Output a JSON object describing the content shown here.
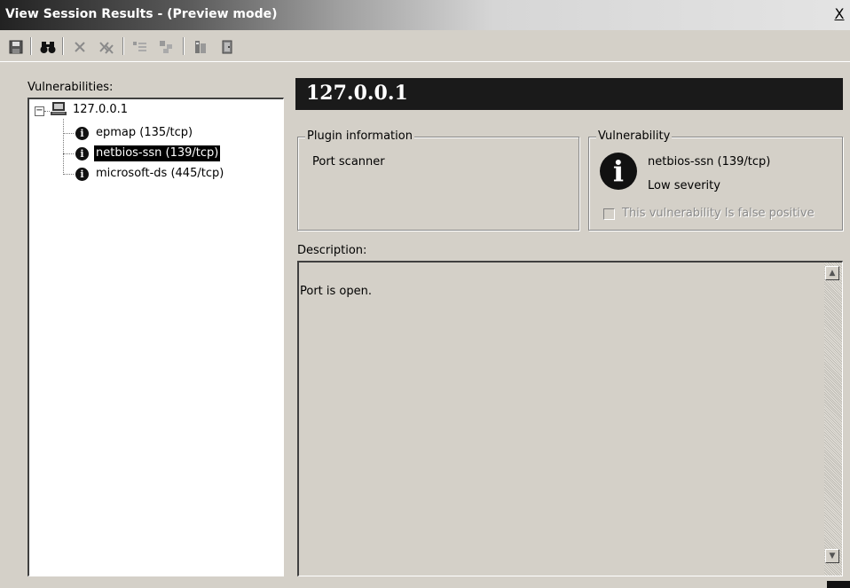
{
  "window": {
    "title": "View Session Results -  (Preview mode)",
    "close_glyph": "X"
  },
  "toolbar": {
    "buttons": [
      {
        "icon": "save-icon"
      },
      {
        "icon": "find-binoculars-icon"
      },
      {
        "icon": "delete-icon"
      },
      {
        "icon": "delete-all-icon"
      },
      {
        "icon": "collapse-icon"
      },
      {
        "icon": "expand-icon"
      },
      {
        "icon": "report-icon"
      },
      {
        "icon": "exit-icon"
      }
    ]
  },
  "vulnerabilities_panel": {
    "label": "Vulnerabilities:",
    "tree": {
      "root": {
        "label": "127.0.0.1",
        "expander": "−",
        "icon": "computer-icon"
      },
      "children": [
        {
          "label": "epmap (135/tcp)",
          "selected": false,
          "icon": "info-icon"
        },
        {
          "label": "netbios-ssn (139/tcp)",
          "selected": true,
          "icon": "info-icon"
        },
        {
          "label": "microsoft-ds (445/tcp)",
          "selected": false,
          "icon": "info-icon"
        }
      ]
    }
  },
  "detail": {
    "header": "127.0.0.1",
    "plugin_info": {
      "title": "Plugin information",
      "value": "Port scanner"
    },
    "vulnerability": {
      "title": "Vulnerability",
      "name": "netbios-ssn (139/tcp)",
      "severity": "Low severity",
      "false_positive_label": "This vulnerability Is false positive",
      "false_positive_checked": false,
      "info_glyph": "i"
    },
    "description": {
      "label": "Description:",
      "text": "Port is open."
    }
  },
  "colors": {
    "window_bg": "#d4d0c8",
    "selection_bg": "#000000",
    "header_bg": "#1a1a1a"
  }
}
